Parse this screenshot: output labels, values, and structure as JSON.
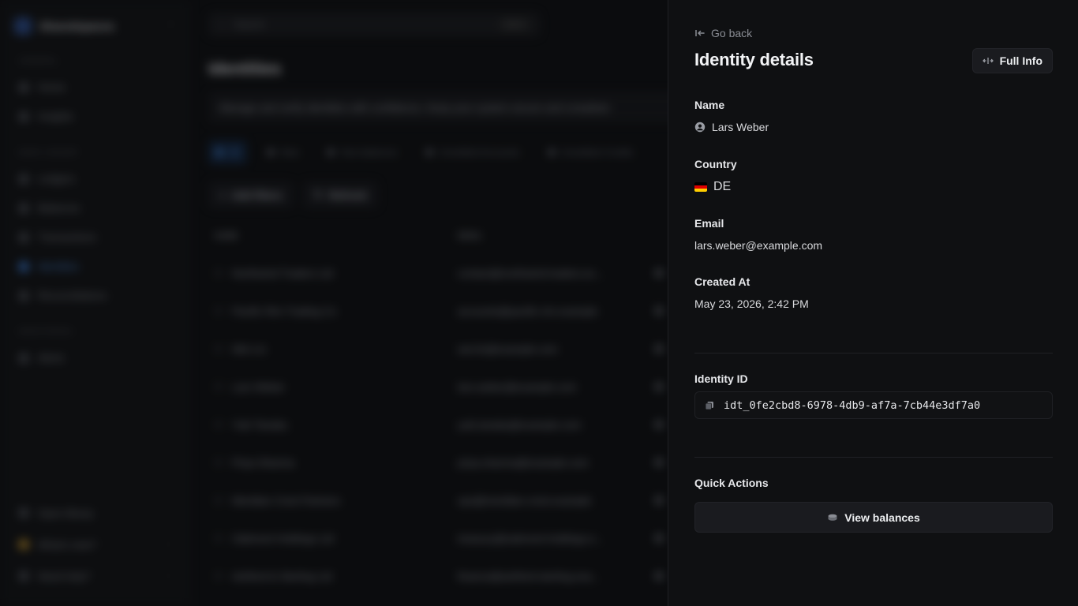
{
  "background": {
    "workspace": "Sharedspaces",
    "sections": [
      {
        "label": "General",
        "items": [
          "Home",
          "Insights"
        ]
      },
      {
        "label": "Bank Ledger",
        "items": [
          "Ledgers",
          "Balances",
          "Transactions",
          "Identities",
          "Reconciliations"
        ]
      },
      {
        "label": "Monitoring",
        "items": [
          "Alerts"
        ]
      }
    ],
    "bottom_items": [
      "Open library",
      "What's new?",
      "Need help?"
    ],
    "search_placeholder": "Search",
    "search_shortcut": "Ctrl K",
    "page_title": "Identities",
    "page_desc": "Manage and verify identities with confidence. Keep your system secure and compliant.",
    "filter_tabs": [
      "All",
      "New",
      "Has balances",
      "Unsettled Accounts",
      "Unsettled Credits"
    ],
    "tools": [
      "Add filters",
      "Refresh"
    ],
    "columns": [
      "NAME",
      "EMAIL"
    ],
    "rows": [
      {
        "name": "Northwind Traders Ltd",
        "email": "contact@northwind-traders.ex..."
      },
      {
        "name": "Pacific Rim Trading Co",
        "email": "accounts@pacific-rim.example"
      },
      {
        "name": "Wei Lin",
        "email": "wei.lin@example.com"
      },
      {
        "name": "Lars Weber",
        "email": "lars.weber@example.com"
      },
      {
        "name": "Yuki Tanaka",
        "email": "yuki.tanaka@example.com"
      },
      {
        "name": "Priya Sharma",
        "email": "priya.sharma@example.com"
      },
      {
        "name": "Meridian Crest Partners",
        "email": "ops@meridian-crest.example"
      },
      {
        "name": "Oakmont Holdings Ltd",
        "email": "treasury@oakmont-holdings.e..."
      },
      {
        "name": "Ashford & Sterling Ltd",
        "email": "finance@ashford-sterling.exa..."
      }
    ]
  },
  "panel": {
    "back_label": "Go back",
    "title": "Identity details",
    "full_info_label": "Full Info",
    "name_label": "Name",
    "name_value": "Lars Weber",
    "country_label": "Country",
    "country_value": "DE",
    "email_label": "Email",
    "email_value": "lars.weber@example.com",
    "created_label": "Created At",
    "created_value": "May 23, 2026, 2:42 PM",
    "identity_id_label": "Identity ID",
    "identity_id_value": "idt_0fe2cbd8-6978-4db9-af7a-7cb44e3df7a0",
    "quick_actions_label": "Quick Actions",
    "view_balances_label": "View balances",
    "icons": [
      "arrow-left-bar-icon",
      "expand-arrows-icon",
      "user-circle-icon",
      "germany-flag-icon",
      "copy-icon",
      "coins-icon"
    ]
  }
}
